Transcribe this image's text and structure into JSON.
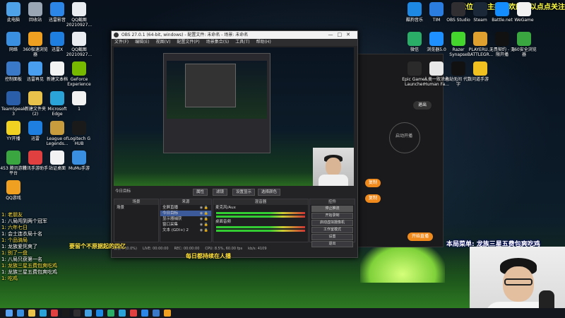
{
  "desktop": {
    "left_icons": [
      {
        "label": "此电脑",
        "color": "#4ea3e8"
      },
      {
        "label": "回收站",
        "color": "#9aa6b4"
      },
      {
        "label": "迅雷影音",
        "color": "#2b86e8"
      },
      {
        "label": "QQ截图20210927...",
        "color": "#e9edf2"
      },
      {
        "label": "网络",
        "color": "#3b8fe0"
      },
      {
        "label": "360极速浏览器",
        "color": "#f0a020"
      },
      {
        "label": "迅雷X",
        "color": "#1e7fe0"
      },
      {
        "label": "QQ截图20210927...",
        "color": "#e9edf2"
      },
      {
        "label": "控制面板",
        "color": "#3a78c8"
      },
      {
        "label": "迅雷再见",
        "color": "#4a9ef0"
      },
      {
        "label": "新建文本档",
        "color": "#f2f2f2"
      },
      {
        "label": "GeForce Experience",
        "color": "#76b900"
      },
      {
        "label": "TeamSpeak 3",
        "color": "#2a5ea8"
      },
      {
        "label": "新建文件夹(2)",
        "color": "#e8c24a"
      },
      {
        "label": "Microsoft Edge",
        "color": "#2aa3d8"
      },
      {
        "label": "1",
        "color": "#f2f2f2"
      },
      {
        "label": "YY开播",
        "color": "#f0d020"
      },
      {
        "label": "迅雷",
        "color": "#1e7fe0"
      },
      {
        "label": "League of Legends...",
        "color": "#c89b3c"
      },
      {
        "label": "Logitech G HUB",
        "color": "#1a1a1a"
      },
      {
        "label": "453 腾讯游戏平台",
        "color": "#3aa640"
      },
      {
        "label": "腾讯手游助手",
        "color": "#e04040"
      },
      {
        "label": "站证桌面",
        "color": "#f2f2f2"
      },
      {
        "label": "MuMu手游",
        "color": "#3a8fe0"
      },
      {
        "label": "QQ游戏",
        "color": "#f0a020"
      }
    ],
    "right_icons": [
      {
        "label": "酷狗音乐",
        "color": "#1e88e5"
      },
      {
        "label": "TIM",
        "color": "#2b7de0"
      },
      {
        "label": "OBS Studio",
        "color": "#302e31"
      },
      {
        "label": "Steam",
        "color": "#1b2838"
      },
      {
        "label": "Battle.net",
        "color": "#148eff"
      },
      {
        "label": "WeGame",
        "color": "#f2f2f2"
      },
      {
        "label": "微信",
        "color": "#2aae67"
      },
      {
        "label": "浏览器5.0",
        "color": "#1e90ff"
      },
      {
        "label": "Razer Synapse",
        "color": "#44d62c"
      },
      {
        "label": "PLAYERU... BATTLEGR...",
        "color": "#e0a030"
      },
      {
        "label": "无畏契约 - 无限开播",
        "color": "#111111"
      },
      {
        "label": "360安全浏览器",
        "color": "#3aa640"
      },
      {
        "label": "Epic Games Launcher",
        "color": "#2a2a2a"
      },
      {
        "label": "人类一败涂地Human Fa...",
        "color": "#e8e8e8"
      },
      {
        "label": "永劫无间 代数字",
        "color": "#111111"
      },
      {
        "label": "问道手游",
        "color": "#f0c020"
      }
    ],
    "taskbar_icon_colors": [
      "#3b8fe0",
      "#e8c24a",
      "#2aa3d8",
      "#e04040",
      "#1a1a1a",
      "#302e31",
      "#44a0e0",
      "#1e88e5",
      "#2aae67",
      "#2aa3d8",
      "#e04040",
      "#2b86e8",
      "#3a78c8",
      "#f0a020"
    ]
  },
  "obs": {
    "title": "OBS 27.0.1 (64-bit, windows) - 配置文件: 未命名 - 场景: 未命名",
    "menu": [
      "文件(F)",
      "编辑(E)",
      "视图(V)",
      "配置文件(P)",
      "场景集合(S)",
      "工具(T)",
      "帮助(H)"
    ],
    "scene_label": "今日目标",
    "scene_buttons": [
      "属性",
      "滤镜",
      "设置显示",
      "选择颜色"
    ],
    "docks": {
      "scenes": {
        "header": "场景",
        "items": [
          "场景"
        ]
      },
      "sources": {
        "header": "来源",
        "items": [
          "全屏直播",
          "今日目标",
          "显示器捕获",
          "窗口采集",
          "文本 (GDI+) 2"
        ]
      },
      "mixer": {
        "header": "混音器",
        "tracks": [
          {
            "name": "麦克风/Aux",
            "level": "0.0 dB"
          },
          {
            "name": "桌面音频",
            "level": "0.0 dB"
          }
        ]
      },
      "controls": {
        "header": "控件",
        "buttons": [
          "停止推流",
          "开始录制",
          "启动虚拟摄像机",
          "工作室模式",
          "设置",
          "退出"
        ]
      }
    },
    "status": [
      "丢帧 0 (0.0%)",
      "LIVE: 00:00:00",
      "REC: 00:00:00",
      "CPU: 8.5%, 60.00 fps",
      "kb/s: 4109"
    ]
  },
  "side_panel": {
    "exit_label": "退出",
    "circle_label": "启动开播",
    "buttons": [
      "复制",
      "复制",
      "开始直播"
    ]
  },
  "overlays": {
    "marquee": "游戏位暂活主播喜欢的可以点点关注",
    "today_menu": "本局菜单: 龙族三星五费包爽吃鸡",
    "subtitle": "每日都持续在人播",
    "mid_warn": "要留个不原据起的四亿",
    "chat": [
      {
        "text": "1: 老朋友",
        "hl": true
      },
      {
        "text": "1: 八局闯到两个冠军",
        "hl": false
      },
      {
        "text": "1: 六年七日",
        "hl": true
      },
      {
        "text": "1: 会士连衣局十名",
        "hl": false
      },
      {
        "text": "1: 个品骑局",
        "hl": true
      },
      {
        "text": "1: 龙族爱死爽了",
        "hl": false
      },
      {
        "text": "1: 别了一盘",
        "hl": true
      },
      {
        "text": "1: 八局只获第一名",
        "hl": false
      },
      {
        "text": "1: 龙族三星五费包爽吃鸡",
        "hl": true
      },
      {
        "text": "1: 龙族三星五费包爽吃鸡",
        "hl": false
      },
      {
        "text": "1: 吃鸡",
        "hl": true
      }
    ]
  }
}
